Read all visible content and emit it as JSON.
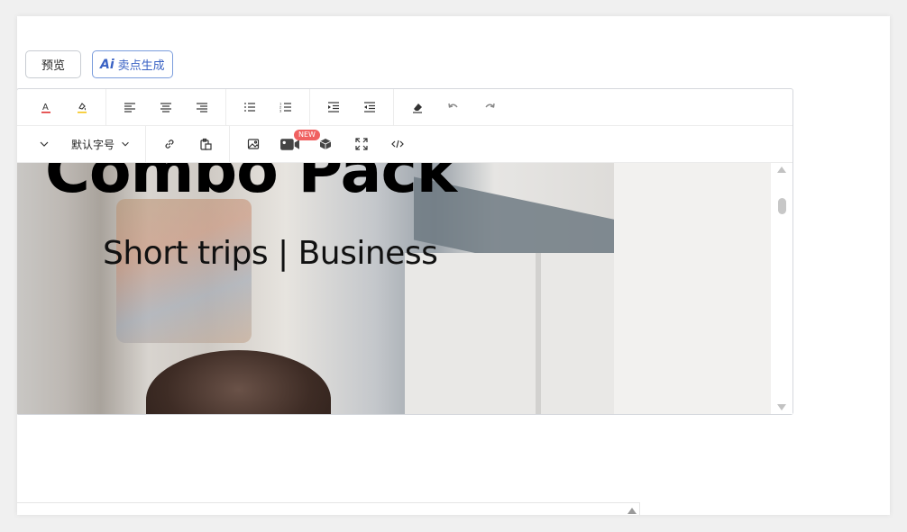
{
  "buttons": {
    "preview_label": "预览",
    "ai_logo": "Ai",
    "ai_label": "卖点生成"
  },
  "toolbar": {
    "font_size_label": "默认字号",
    "new_badge": "NEW",
    "icons_row1": [
      "font-color-icon",
      "highlight-icon",
      "align-left-icon",
      "align-center-icon",
      "align-right-icon",
      "bulleted-list-icon",
      "numbered-list-icon",
      "indent-icon",
      "outdent-icon",
      "eraser-icon",
      "undo-icon",
      "redo-icon"
    ],
    "icons_row2": [
      "chevron-down-icon",
      "link-icon",
      "paste-icon",
      "image-icon",
      "video-icon",
      "cube-icon",
      "fullscreen-icon",
      "code-icon"
    ]
  },
  "content": {
    "headline": "Combo Pack",
    "subline": "Short trips | Business"
  },
  "colors": {
    "accent": "#3a62c4",
    "badge": "#f06161",
    "font_color_underline": "#e03131",
    "highlight_underline": "#f5c518"
  }
}
